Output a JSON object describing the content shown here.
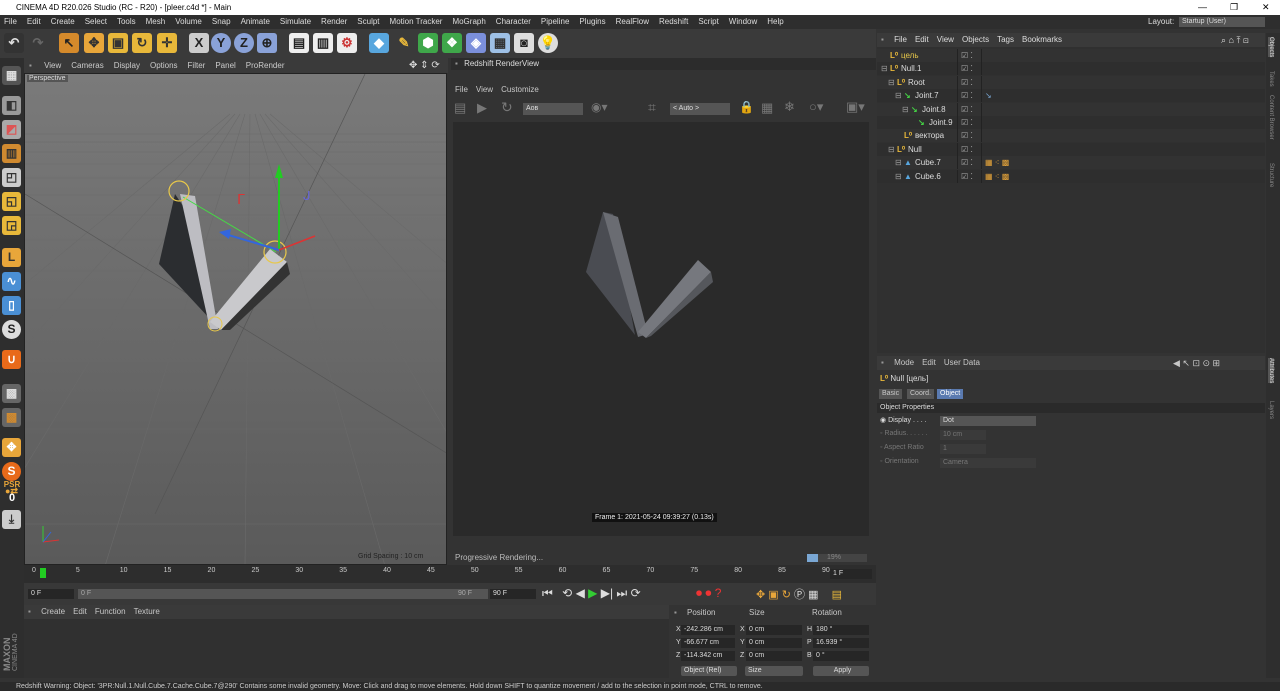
{
  "titlebar": {
    "title": "CINEMA 4D R20.026 Studio (RC - R20) - [pleer.c4d *] - Main"
  },
  "menubar": {
    "items": [
      "File",
      "Edit",
      "Create",
      "Select",
      "Tools",
      "Mesh",
      "Volume",
      "Snap",
      "Animate",
      "Simulate",
      "Render",
      "Sculpt",
      "Motion Tracker",
      "MoGraph",
      "Character",
      "Pipeline",
      "Plugins",
      "RealFlow",
      "Redshift",
      "Script",
      "Window",
      "Help"
    ],
    "layout_label": "Layout:",
    "layout_value": "Startup (User)"
  },
  "viewport": {
    "menu": [
      "View",
      "Cameras",
      "Display",
      "Options",
      "Filter",
      "Panel",
      "ProRender"
    ],
    "camera_label": "Perspective",
    "grid_spacing": "Grid Spacing : 10 cm"
  },
  "renderview": {
    "title": "Redshift RenderView",
    "menu": [
      "File",
      "View",
      "Customize"
    ],
    "aov": "Аов",
    "size": "< Auto >",
    "frame_info": "Frame 1: 2021-05-24 09:39:27 (0.13s)",
    "status": "Progressive Rendering...",
    "progress_text": "19%",
    "progress": 0.19
  },
  "objects": {
    "menu": [
      "File",
      "Edit",
      "View",
      "Objects",
      "Tags",
      "Bookmarks"
    ],
    "rows": [
      {
        "name": "цель",
        "depth": 0
      },
      {
        "name": "Null.1",
        "depth": 0
      },
      {
        "name": "Root",
        "depth": 1
      },
      {
        "name": "Joint.7",
        "depth": 2
      },
      {
        "name": "Joint.8",
        "depth": 3
      },
      {
        "name": "Joint.9",
        "depth": 4
      },
      {
        "name": "вектора",
        "depth": 2
      },
      {
        "name": "Null",
        "depth": 1
      },
      {
        "name": "Cube.7",
        "depth": 2
      },
      {
        "name": "Cube.6",
        "depth": 2
      }
    ]
  },
  "attributes": {
    "menu": [
      "Mode",
      "Edit",
      "User Data"
    ],
    "object_name": "Null [цель]",
    "tabs": [
      "Basic",
      "Coord.",
      "Object"
    ],
    "active_tab": "Object",
    "section": "Object Properties",
    "props": [
      {
        "label": "Display . . . .",
        "value": "Dot"
      },
      {
        "label": "Radius. . . . . .",
        "value": "10 cm"
      },
      {
        "label": "Aspect Ratio",
        "value": "1"
      },
      {
        "label": "Orientation",
        "value": "Camera"
      }
    ]
  },
  "sidetabs": [
    "Objects",
    "Takes",
    "Content Browser",
    "Structure",
    "Attributes",
    "Layers"
  ],
  "timeline": {
    "ticks": [
      "0",
      "5",
      "10",
      "15",
      "20",
      "25",
      "30",
      "35",
      "40",
      "45",
      "50",
      "55",
      "60",
      "65",
      "70",
      "75",
      "80",
      "85",
      "90"
    ],
    "current_frame": "1 F",
    "start": "0 F",
    "end": "90 F",
    "preview_start": "0 F",
    "preview_end": "90 F"
  },
  "material": {
    "menu": [
      "Create",
      "Edit",
      "Function",
      "Texture"
    ]
  },
  "coordinates": {
    "headers": [
      "Position",
      "Size",
      "Rotation"
    ],
    "rows": [
      {
        "axis": "X",
        "pos": "-242.286 cm",
        "size": "0 cm",
        "rot_axis": "H",
        "rot": "180 °"
      },
      {
        "axis": "Y",
        "pos": "-66.677 cm",
        "size": "0 cm",
        "rot_axis": "P",
        "rot": "16.939 °"
      },
      {
        "axis": "Z",
        "pos": "-114.342 cm",
        "size": "0 cm",
        "rot_axis": "B",
        "rot": "0 °"
      }
    ],
    "mode": "Object (Rel)",
    "size_mode": "Size",
    "apply": "Apply"
  },
  "statusbar": {
    "text": "Redshift Warning: Object: '3PR:Null.1.Null.Cube.7.Cache.Cube.7@290' Contains some invalid geometry.     Move: Click and drag to move elements. Hold down SHIFT to quantize movement / add to the selection in point mode, CTRL to remove."
  },
  "brand": {
    "maxon": "MAXON",
    "product": "CINEMA 4D"
  }
}
